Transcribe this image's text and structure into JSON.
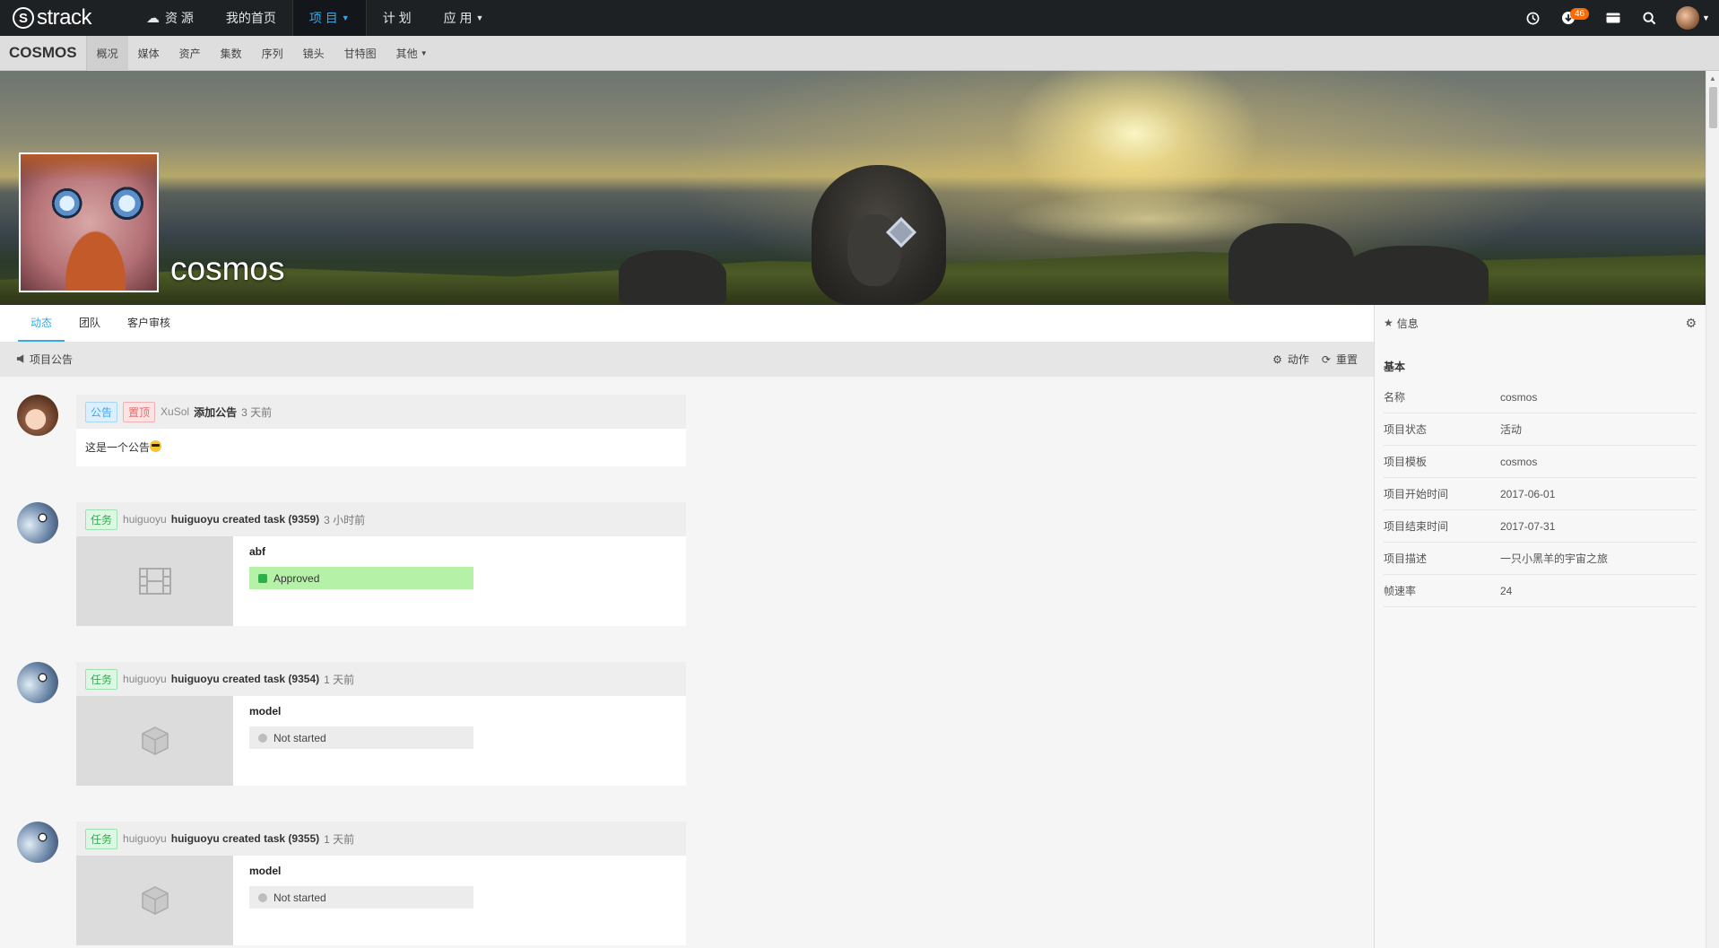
{
  "app": {
    "logo_letter": "S",
    "logo_text": "strack"
  },
  "topnav": {
    "items": [
      {
        "label": "资 源",
        "icon": "cloud-icon"
      },
      {
        "label": "我的首页"
      },
      {
        "label": "项 目",
        "active": true,
        "has_dropdown": true
      },
      {
        "label": "计 划"
      },
      {
        "label": "应 用",
        "has_dropdown": true
      }
    ],
    "notification_count": "46",
    "right_icons": [
      "clock-icon",
      "download-icon",
      "message-icon",
      "search-icon",
      "user-avatar"
    ],
    "accent_color": "#3aa8e6"
  },
  "subnav": {
    "project_code": "COSMOS",
    "items": [
      "概况",
      "媒体",
      "资产",
      "集数",
      "序列",
      "镜头",
      "甘特图",
      "其他"
    ],
    "active_index": 0
  },
  "banner": {
    "title": "cosmos"
  },
  "tabs": {
    "items": [
      "动态",
      "团队",
      "客户审核"
    ],
    "active_index": 0
  },
  "announcement_bar": {
    "label": "项目公告",
    "actions": [
      "动作",
      "重置"
    ]
  },
  "feed": [
    {
      "tags": [
        "公告",
        "置顶"
      ],
      "user": "XuSol",
      "action": "添加公告",
      "time": "3 天前",
      "text": "这是一个公告"
    },
    {
      "tags": [
        "任务"
      ],
      "user": "huiguoyu",
      "action": "huiguoyu created task (9359)",
      "time": "3 小时前",
      "task_name": "abf",
      "status": "Approved"
    },
    {
      "tags": [
        "任务"
      ],
      "user": "huiguoyu",
      "action": "huiguoyu created task (9354)",
      "time": "1 天前",
      "task_name": "model",
      "status": "Not started"
    },
    {
      "tags": [
        "任务"
      ],
      "user": "huiguoyu",
      "action": "huiguoyu created task (9355)",
      "time": "1 天前",
      "task_name": "model",
      "status": "Not started"
    }
  ],
  "info_panel": {
    "title": "信息",
    "section": "基本",
    "rows": [
      {
        "key": "名称",
        "value": "cosmos"
      },
      {
        "key": "项目状态",
        "value": "活动"
      },
      {
        "key": "项目模板",
        "value": "cosmos"
      },
      {
        "key": "项目开始时间",
        "value": "2017-06-01"
      },
      {
        "key": "项目结束时间",
        "value": "2017-07-31"
      },
      {
        "key": "项目描述",
        "value": "一只小黑羊的宇宙之旅"
      },
      {
        "key": "帧速率",
        "value": "24"
      }
    ]
  }
}
